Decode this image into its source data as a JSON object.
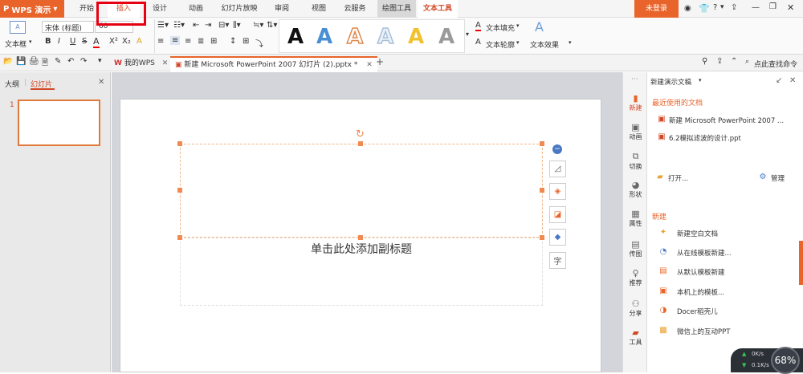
{
  "menubar": {
    "app_label": "WPS 演示",
    "tabs": [
      "开始",
      "插入",
      "设计",
      "动画",
      "幻灯片放映",
      "审阅",
      "视图",
      "云服务",
      "绘图工具",
      "文本工具"
    ],
    "login": "未登录",
    "help": "?"
  },
  "ribbon": {
    "textbox_label": "文本框",
    "font_name": "宋体 (标题)",
    "font_size": "60",
    "fill_label": "文本填充",
    "outline_label": "文本轮廓",
    "effect_label": "文本效果",
    "style_glyph": "A",
    "style_colors": [
      "#111111",
      "#4a8fd4",
      "#e0884a",
      "#a7bfd8",
      "#f2c12e",
      "#9a9a9a"
    ]
  },
  "doc_tabs": {
    "home": "我的WPS",
    "current": "新建 Microsoft PowerPoint 2007 幻灯片 (2).pptx *",
    "search": "点此查找命令"
  },
  "left_panel": {
    "outline_tab": "大纲",
    "slides_tab": "幻灯片",
    "slide_number": "1"
  },
  "slide": {
    "subtitle_placeholder": "单击此处添加副标题"
  },
  "sidebar": {
    "items": [
      "新建",
      "动画",
      "切换",
      "形状",
      "属性",
      "传图",
      "推荐",
      "分享",
      "工具"
    ]
  },
  "taskpane": {
    "title": "新建演示文稿",
    "recent_header": "最近使用的文档",
    "recent_docs": [
      "新建 Microsoft PowerPoint 2007 ...",
      "6.2模拟滤波的设计.ppt"
    ],
    "open": "打开...",
    "manage": "管理",
    "new_header": "新建",
    "new_items": [
      "新建空白文档",
      "从在线模板新建...",
      "从默认模板新建",
      "本机上的模板...",
      "Docer稻壳儿",
      "微信上的互动PPT"
    ]
  },
  "speed": {
    "upload": "0K/s",
    "download": "0.1K/s",
    "percent": "68%"
  },
  "colors": {
    "accent": "#e8642a",
    "highlight": "#e60012"
  }
}
